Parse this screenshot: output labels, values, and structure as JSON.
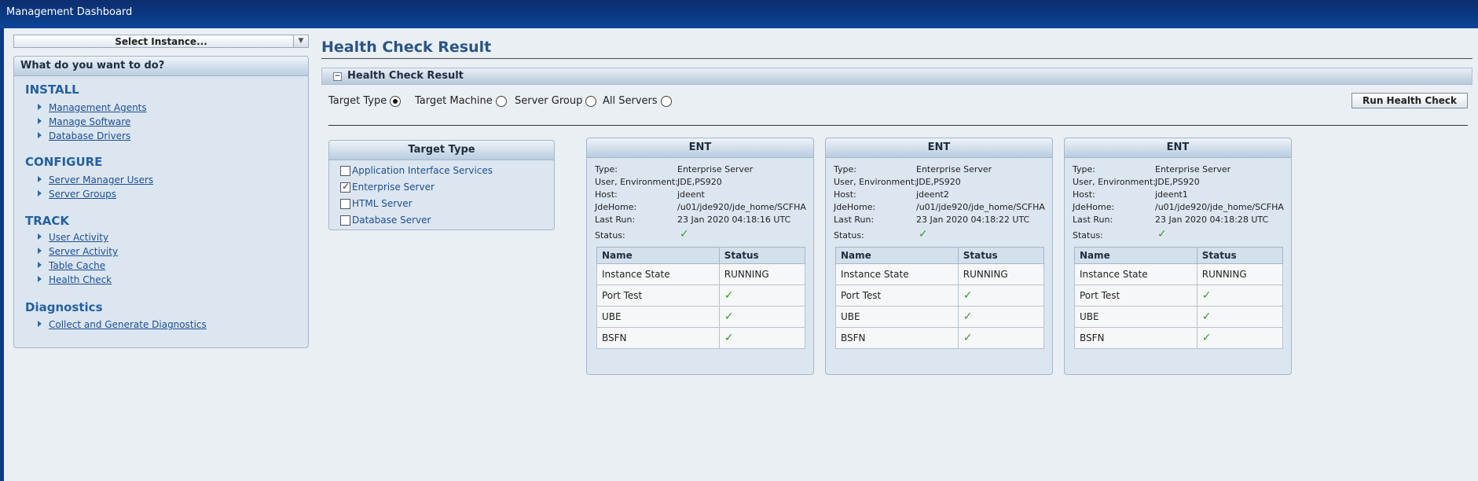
{
  "app": {
    "title": "Management Dashboard"
  },
  "sidebar": {
    "instance_select": "Select Instance...",
    "panel_title": "What do you want to do?",
    "sections": [
      {
        "title": "INSTALL",
        "links": [
          "Management Agents",
          "Manage Software",
          "Database Drivers"
        ]
      },
      {
        "title": "CONFIGURE",
        "links": [
          "Server Manager Users",
          "Server Groups"
        ]
      },
      {
        "title": "TRACK",
        "links": [
          "User Activity",
          "Server Activity",
          "Table Cache",
          "Health Check"
        ]
      },
      {
        "title": "Diagnostics",
        "links": [
          "Collect and Generate Diagnostics"
        ]
      }
    ]
  },
  "main": {
    "page_title": "Health Check Result",
    "section_title": "Health Check Result",
    "radios": [
      {
        "label": "Target Type",
        "selected": true
      },
      {
        "label": "Target Machine",
        "selected": false
      },
      {
        "label": "Server Group",
        "selected": false
      },
      {
        "label": "All Servers",
        "selected": false
      }
    ],
    "run_button": "Run Health Check",
    "target_panel": {
      "title": "Target Type",
      "options": [
        {
          "label": "Application Interface Services",
          "checked": false
        },
        {
          "label": "Enterprise Server",
          "checked": true
        },
        {
          "label": "HTML Server",
          "checked": false
        },
        {
          "label": "Database Server",
          "checked": false
        }
      ]
    },
    "field_labels": {
      "type": "Type:",
      "user_env": "User, Environment:",
      "host": "Host:",
      "jde_home": "JdeHome:",
      "last_run": "Last Run:",
      "status": "Status:"
    },
    "table_headers": {
      "name": "Name",
      "status": "Status"
    },
    "cards": [
      {
        "title": "ENT",
        "type": "Enterprise Server",
        "user_env": "JDE,PS920",
        "host": "jdeent",
        "jde_home": "/u01/jde920/jde_home/SCFHA",
        "last_run": "23 Jan 2020 04:18:16 UTC",
        "rows": [
          {
            "name": "Instance State",
            "status": "RUNNING"
          },
          {
            "name": "Port Test",
            "status": "ok"
          },
          {
            "name": "UBE",
            "status": "ok"
          },
          {
            "name": "BSFN",
            "status": "ok"
          }
        ]
      },
      {
        "title": "ENT",
        "type": "Enterprise Server",
        "user_env": "JDE,PS920",
        "host": "jdeent2",
        "jde_home": "/u01/jde920/jde_home/SCFHA",
        "last_run": "23 Jan 2020 04:18:22 UTC",
        "rows": [
          {
            "name": "Instance State",
            "status": "RUNNING"
          },
          {
            "name": "Port Test",
            "status": "ok"
          },
          {
            "name": "UBE",
            "status": "ok"
          },
          {
            "name": "BSFN",
            "status": "ok"
          }
        ]
      },
      {
        "title": "ENT",
        "type": "Enterprise Server",
        "user_env": "JDE,PS920",
        "host": "jdeent1",
        "jde_home": "/u01/jde920/jde_home/SCFHA",
        "last_run": "23 Jan 2020 04:18:28 UTC",
        "rows": [
          {
            "name": "Instance State",
            "status": "RUNNING"
          },
          {
            "name": "Port Test",
            "status": "ok"
          },
          {
            "name": "UBE",
            "status": "ok"
          },
          {
            "name": "BSFN",
            "status": "ok"
          }
        ]
      }
    ]
  },
  "icons": {
    "checkmark": "checkmark-icon",
    "collapse": "collapse-minus-icon",
    "dropdown": "chevron-down-icon"
  },
  "colors": {
    "header_bg": "#0a3a86",
    "link": "#1d4e96",
    "ok": "#3a9a2a",
    "panel_bg": "#dce6f0"
  }
}
